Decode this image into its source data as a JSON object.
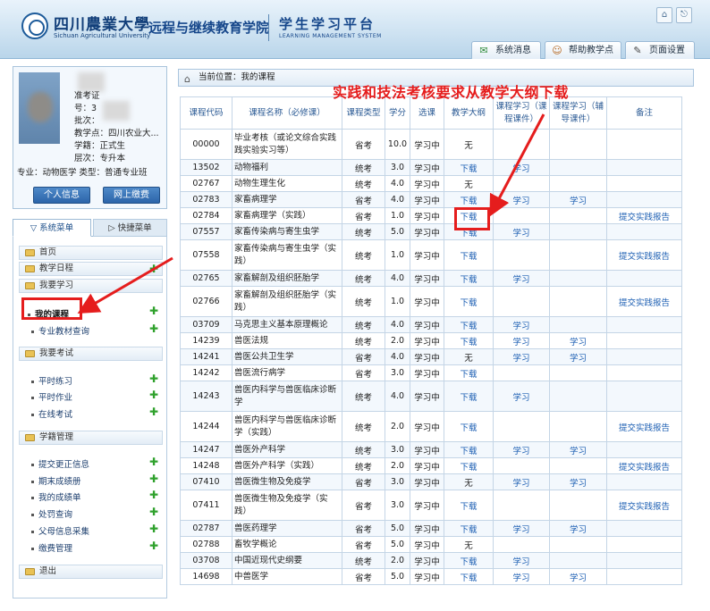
{
  "header": {
    "logo_cn": "四川農業大學",
    "logo_en": "Sichuan Agricultural University",
    "college": "远程与继续教育学院",
    "platform_cn": "学生学习平台",
    "platform_en": "LEARNING MANAGEMENT SYSTEM",
    "tabs": [
      "系统消息",
      "帮助教学点",
      "页面设置"
    ]
  },
  "user": {
    "lines": [
      "准考证",
      "号：3",
      "批次：",
      "教学点：四川农业大...",
      "学籍：正式生",
      "层次：专升本",
      "专业：动物医学  类型：普通专业班"
    ],
    "buttons": [
      "个人信息",
      "网上缴费"
    ]
  },
  "menu": {
    "tabs": [
      "系统菜单",
      "快捷菜单"
    ],
    "sections": [
      {
        "title": "首页"
      },
      {
        "title": "教学日程"
      },
      {
        "title": "我要学习",
        "items": [
          "我的课程",
          "专业教材查询"
        ]
      },
      {
        "title": "我要考试",
        "items": [
          "平时练习",
          "平时作业",
          "在线考试"
        ]
      },
      {
        "title": "学籍管理",
        "items": [
          "提交更正信息",
          "期末成绩册",
          "我的成绩单",
          "处罚查询",
          "父母信息采集",
          "缴费管理"
        ]
      },
      {
        "title": "退出"
      }
    ]
  },
  "breadcrumb": "当前位置：我的课程",
  "annotation": "实践和技法考核要求从教学大纲下载",
  "table": {
    "headers": [
      "课程代码",
      "课程名称（必修课）",
      "课程类型",
      "学分",
      "选课",
      "教学大纲",
      "课程学习（课程课件）",
      "课程学习（辅导课件）",
      "备注"
    ],
    "rows": [
      [
        "00000",
        "毕业考核（或论文综合实践|践实验实习等）",
        "省考",
        "10.0",
        "学习中",
        "无",
        "",
        "",
        ""
      ],
      [
        "13502",
        "动物福利",
        "统考",
        "3.0",
        "学习中",
        "下载",
        "学习",
        "",
        ""
      ],
      [
        "02767",
        "动物生理生化",
        "统考",
        "4.0",
        "学习中",
        "无",
        "",
        "",
        ""
      ],
      [
        "02783",
        "家畜病理学",
        "省考",
        "4.0",
        "学习中",
        "下载",
        "学习",
        "学习",
        ""
      ],
      [
        "02784",
        "家畜病理学（实践）",
        "省考",
        "1.0",
        "学习中",
        "下载",
        "",
        "",
        "提交实践报告"
      ],
      [
        "07557",
        "家畜传染病与寄生虫学",
        "统考",
        "5.0",
        "学习中",
        "下载",
        "学习",
        "",
        ""
      ],
      [
        "07558",
        "家畜传染病与寄生虫学（实|践）",
        "统考",
        "1.0",
        "学习中",
        "下载",
        "",
        "",
        "提交实践报告"
      ],
      [
        "02765",
        "家畜解剖及组织胚胎学",
        "统考",
        "4.0",
        "学习中",
        "下载",
        "学习",
        "",
        ""
      ],
      [
        "02766",
        "家畜解剖及组织胚胎学（实|践）",
        "统考",
        "1.0",
        "学习中",
        "下载",
        "",
        "",
        "提交实践报告"
      ],
      [
        "03709",
        "马克思主义基本原理概论",
        "统考",
        "4.0",
        "学习中",
        "下载",
        "学习",
        "",
        ""
      ],
      [
        "14239",
        "兽医法规",
        "统考",
        "2.0",
        "学习中",
        "下载",
        "学习",
        "学习",
        ""
      ],
      [
        "14241",
        "兽医公共卫生学",
        "省考",
        "4.0",
        "学习中",
        "无",
        "学习",
        "学习",
        ""
      ],
      [
        "14242",
        "兽医流行病学",
        "省考",
        "3.0",
        "学习中",
        "下载",
        "",
        "",
        ""
      ],
      [
        "14243",
        "兽医内科学与兽医临床诊断|学",
        "统考",
        "4.0",
        "学习中",
        "下载",
        "学习",
        "",
        ""
      ],
      [
        "14244",
        "兽医内科学与兽医临床诊断|学（实践）",
        "统考",
        "2.0",
        "学习中",
        "下载",
        "",
        "",
        "提交实践报告"
      ],
      [
        "14247",
        "兽医外产科学",
        "统考",
        "3.0",
        "学习中",
        "下载",
        "学习",
        "学习",
        ""
      ],
      [
        "14248",
        "兽医外产科学（实践）",
        "统考",
        "2.0",
        "学习中",
        "下载",
        "",
        "",
        "提交实践报告"
      ],
      [
        "07410",
        "兽医微生物及免疫学",
        "省考",
        "3.0",
        "学习中",
        "无",
        "学习",
        "学习",
        ""
      ],
      [
        "07411",
        "兽医微生物及免疫学（实|践）",
        "省考",
        "3.0",
        "学习中",
        "下载",
        "",
        "",
        "提交实践报告"
      ],
      [
        "02787",
        "兽医药理学",
        "省考",
        "5.0",
        "学习中",
        "下载",
        "学习",
        "学习",
        ""
      ],
      [
        "02788",
        "畜牧学概论",
        "省考",
        "5.0",
        "学习中",
        "无",
        "",
        "",
        ""
      ],
      [
        "03708",
        "中国近现代史纲要",
        "统考",
        "2.0",
        "学习中",
        "下载",
        "学习",
        "",
        ""
      ],
      [
        "14698",
        "中兽医学",
        "省考",
        "5.0",
        "学习中",
        "下载",
        "学习",
        "学习",
        ""
      ]
    ]
  },
  "colors": {
    "accent": "#1d5fb3",
    "annotation": "#e51d1d"
  }
}
